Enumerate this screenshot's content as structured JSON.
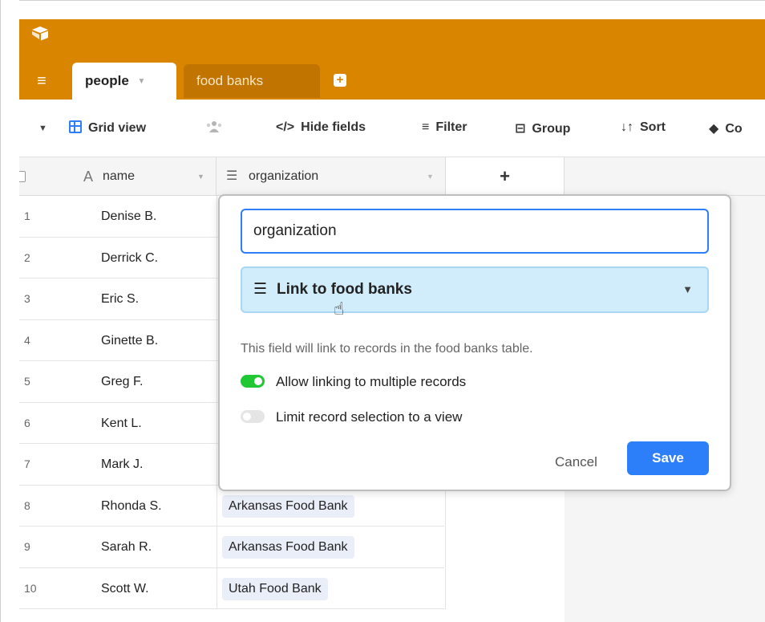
{
  "topbar": {
    "color": "#d98500",
    "tabs": [
      {
        "label": "people",
        "active": true
      },
      {
        "label": "food banks",
        "active": false
      }
    ]
  },
  "toolbar": {
    "view_name": "Grid view",
    "hide_fields": "Hide fields",
    "filter": "Filter",
    "group": "Group",
    "sort": "Sort",
    "color": "Co"
  },
  "grid": {
    "columns": [
      {
        "label": "name",
        "icon": "text-icon"
      },
      {
        "label": "organization",
        "icon": "link-icon"
      }
    ],
    "add_column": "+",
    "rows": [
      {
        "num": "1",
        "name": "Denise B.",
        "org": ""
      },
      {
        "num": "2",
        "name": "Derrick C.",
        "org": ""
      },
      {
        "num": "3",
        "name": "Eric S.",
        "org": ""
      },
      {
        "num": "4",
        "name": "Ginette B.",
        "org": ""
      },
      {
        "num": "5",
        "name": "Greg F.",
        "org": ""
      },
      {
        "num": "6",
        "name": "Kent L.",
        "org": ""
      },
      {
        "num": "7",
        "name": "Mark J.",
        "org": ""
      },
      {
        "num": "8",
        "name": "Rhonda S.",
        "org": "Arkansas Food Bank"
      },
      {
        "num": "9",
        "name": "Sarah R.",
        "org": "Arkansas Food Bank"
      },
      {
        "num": "10",
        "name": "Scott W.",
        "org": "Utah Food Bank"
      }
    ]
  },
  "popup": {
    "field_name": "organization",
    "field_type": "Link to food banks",
    "description": "This field will link to records in the food banks table.",
    "option_multiple": "Allow linking to multiple records",
    "option_multiple_on": true,
    "option_view": "Limit record selection to a view",
    "option_view_on": false,
    "cancel": "Cancel",
    "save": "Save"
  },
  "colors": {
    "accent": "#2d7ff9",
    "toggle_on": "#20c933",
    "select_bg": "#d1ecfb"
  }
}
